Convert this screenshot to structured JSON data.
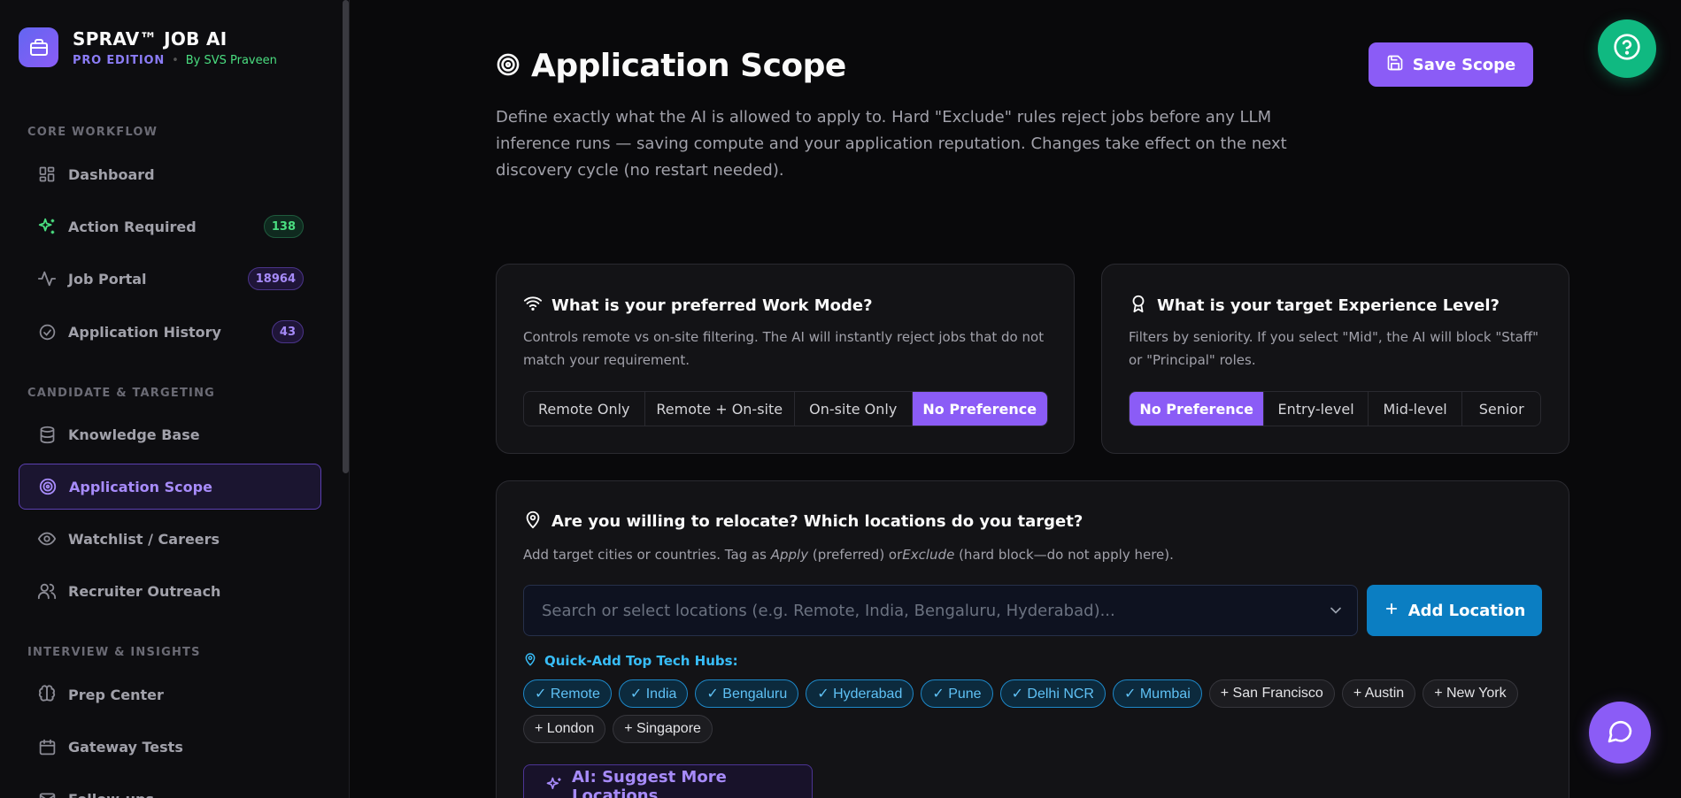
{
  "brand": {
    "title": "SPRAV™ JOB AI",
    "edition": "PRO EDITION",
    "separator": "•",
    "author": "By SVS Praveen"
  },
  "sidebar": {
    "sections": [
      {
        "label": "CORE WORKFLOW"
      },
      {
        "label": "CANDIDATE & TARGETING"
      },
      {
        "label": "INTERVIEW & INSIGHTS"
      }
    ],
    "items": [
      {
        "label": "Dashboard",
        "icon": "dashboard-icon"
      },
      {
        "label": "Action Required",
        "icon": "sparkles-icon",
        "badge": "138",
        "badge_color": "#4ade80"
      },
      {
        "label": "Job Portal",
        "icon": "activity-icon",
        "badge": "18964",
        "badge_color": "#a78bfa"
      },
      {
        "label": "Application History",
        "icon": "check-circle-icon",
        "badge": "43",
        "badge_color": "#a78bfa"
      },
      {
        "label": "Knowledge Base",
        "icon": "database-icon"
      },
      {
        "label": "Application Scope",
        "icon": "target-icon",
        "active": true
      },
      {
        "label": "Watchlist / Careers",
        "icon": "eye-icon"
      },
      {
        "label": "Recruiter Outreach",
        "icon": "users-icon"
      },
      {
        "label": "Prep Center",
        "icon": "brain-icon"
      },
      {
        "label": "Gateway Tests",
        "icon": "calendar-icon"
      },
      {
        "label": "Follow-ups",
        "icon": "mail-icon"
      }
    ]
  },
  "header": {
    "title": "Application Scope",
    "description": "Define exactly what the AI is allowed to apply to. Hard \"Exclude\" rules reject jobs before any LLM inference runs — saving compute and your application reputation. Changes take effect on the next discovery cycle (no restart needed).",
    "save_label": "Save Scope"
  },
  "work_mode": {
    "title": "What is your preferred Work Mode?",
    "description": "Controls remote vs on-site filtering. The AI will instantly reject jobs that do not match your requirement.",
    "options": [
      "Remote Only",
      "Remote + On-site",
      "On-site Only",
      "No Preference"
    ],
    "selected": "No Preference"
  },
  "experience": {
    "title": "What is your target Experience Level?",
    "description": "Filters by seniority. If you select \"Mid\", the AI will block \"Staff\" or \"Principal\" roles.",
    "options": [
      "No Preference",
      "Entry-level",
      "Mid-level",
      "Senior"
    ],
    "selected": "No Preference"
  },
  "locations": {
    "title": "Are you willing to relocate? Which locations do you target?",
    "desc_pre": "Add target cities or countries. Tag as ",
    "desc_apply": "Apply",
    "desc_mid": " (preferred) or",
    "desc_exclude": "Exclude",
    "desc_post": " (hard block—do not apply here).",
    "search_placeholder": "Search or select locations (e.g. Remote, India, Bengaluru, Hyderabad)...",
    "add_label": "Add Location",
    "quick_add_label": "Quick-Add Top Tech Hubs:",
    "hubs": [
      {
        "label": "✓ Remote",
        "on": true
      },
      {
        "label": "✓ India",
        "on": true
      },
      {
        "label": "✓ Bengaluru",
        "on": true
      },
      {
        "label": "✓ Hyderabad",
        "on": true
      },
      {
        "label": "✓ Pune",
        "on": true
      },
      {
        "label": "✓ Delhi NCR",
        "on": true
      },
      {
        "label": "✓ Mumbai",
        "on": true
      },
      {
        "label": "+ San Francisco",
        "on": false
      },
      {
        "label": "+ Austin",
        "on": false
      },
      {
        "label": "+ New York",
        "on": false
      },
      {
        "label": "+ London",
        "on": false
      },
      {
        "label": "+ Singapore",
        "on": false
      }
    ],
    "suggest_label": "AI: Suggest More Locations"
  },
  "colors": {
    "accent": "#8b5cf6",
    "help": "#10b981",
    "add": "#0b7ec2",
    "hub_on": "#38bdf8"
  }
}
